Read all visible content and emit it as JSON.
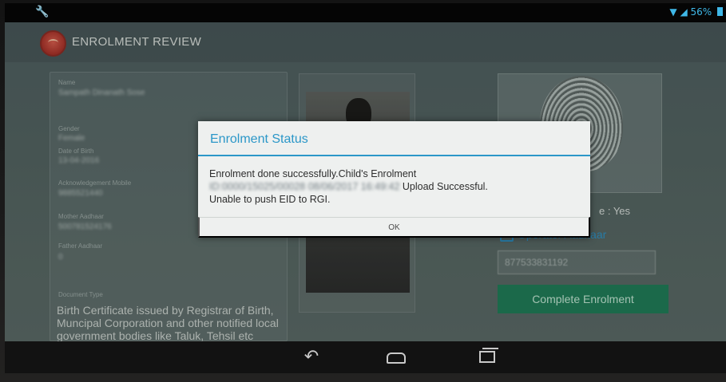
{
  "status_bar": {
    "battery_text": "56%"
  },
  "app": {
    "title": "ENROLMENT REVIEW"
  },
  "details": {
    "name_label": "Name",
    "name_value": "Sampath Dinanath Sose",
    "gender_label": "Gender",
    "gender_value": "Female",
    "dob_label": "Date of Birth",
    "dob_value": "13-04-2016",
    "ack_mobile_label": "Acknowledgement Mobile",
    "ack_mobile_value": "9885521440",
    "mother_aadhaar_label": "Mother Aadhaar",
    "mother_aadhaar_value": "500781524176",
    "father_aadhaar_label": "Father Aadhaar",
    "father_aadhaar_value": "0",
    "document_type_label": "Document Type",
    "document_type_value": "Birth Certificate issued by Registrar of Birth, Muncipal Corporation and other notified local government bodies like Taluk, Tehsil etc"
  },
  "consent": {
    "text": "e : Yes"
  },
  "operator": {
    "label": "Operator Aadhaar",
    "value": "877533831192"
  },
  "complete_button": {
    "label": "Complete Enrolment"
  },
  "dialog": {
    "title": "Enrolment Status",
    "message_line1": "Enrolment done successfully.Child's Enrolment",
    "eid": "ID:0000/15025/00028 08/06/2017 16:49:42",
    "message_upload": " Upload Successful.",
    "message_line3": "Unable to push EID to RGI.",
    "ok_label": "OK"
  },
  "colors": {
    "accent": "#2b97c8",
    "button": "#1f7a55",
    "brand": "#a52f26"
  }
}
